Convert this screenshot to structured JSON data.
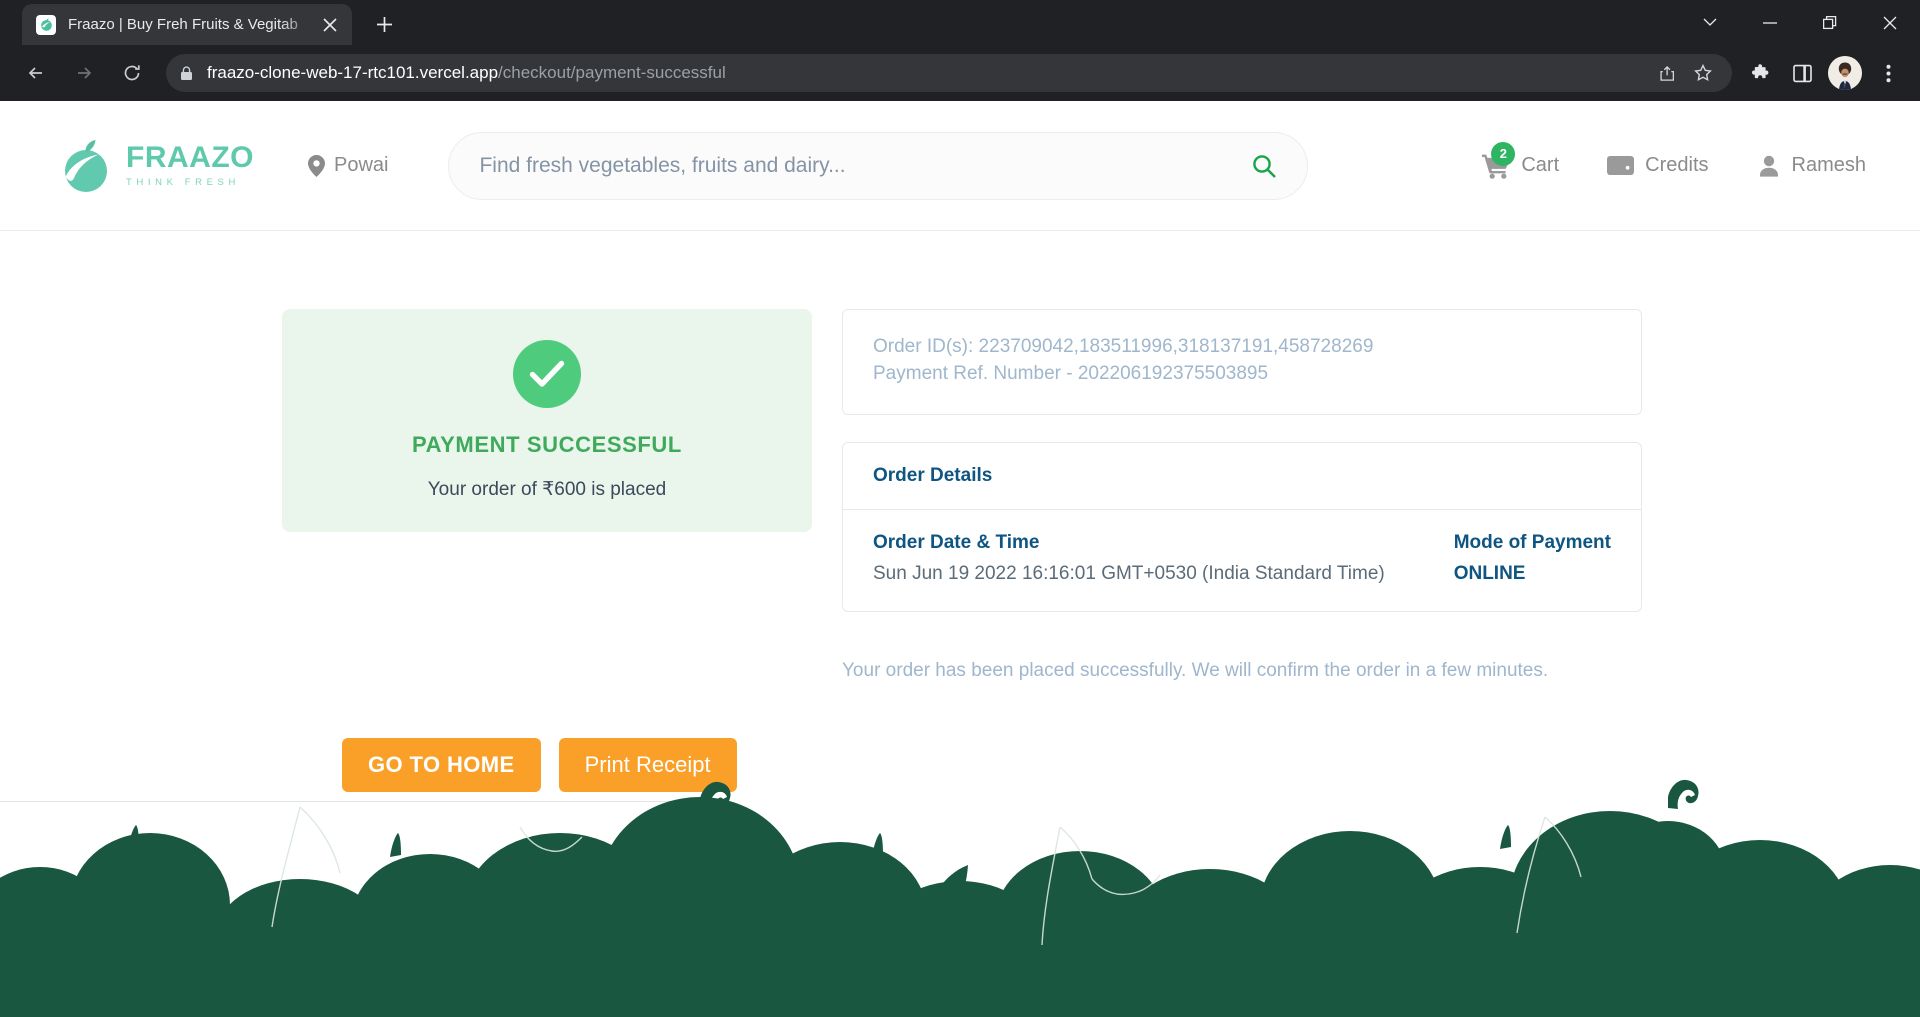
{
  "browser": {
    "tab": {
      "title": "Fraazo | Buy Freh Fruits & Vegitab",
      "favicon_name": "fraazo-favicon",
      "close_label": "✕"
    },
    "new_tab_label": "+",
    "window_controls": {
      "tab_search_label": "∨",
      "minimize_label": "—",
      "maximize_label": "❐",
      "close_label": "✕"
    },
    "nav": {
      "back_label": "←",
      "forward_label": "→",
      "reload_label": "⟳"
    },
    "omnibox": {
      "host": "fraazo-clone-web-17-rtc101.vercel.app",
      "path": "/checkout/payment-successful",
      "lock_icon": "lock-icon",
      "share_icon": "share-icon",
      "bookmark_icon": "star-icon"
    },
    "toolbar": {
      "extensions_icon": "puzzle-icon",
      "side_panel_icon": "side-panel-icon",
      "profile_icon": "profile-avatar",
      "menu_icon": "kebab-menu-icon"
    }
  },
  "site_header": {
    "logo": {
      "name": "FRAAZO",
      "tagline": "THINK FRESH"
    },
    "location": {
      "icon": "location-pin-icon",
      "label": "Powai"
    },
    "search": {
      "placeholder": "Find fresh vegetables, fruits and dairy...",
      "value": "",
      "icon": "search-icon"
    },
    "nav_items": [
      {
        "label": "Cart",
        "icon": "shopping-cart-icon",
        "badge": "2"
      },
      {
        "label": "Credits",
        "icon": "wallet-icon",
        "badge": ""
      },
      {
        "label": "Ramesh",
        "icon": "user-icon",
        "badge": ""
      }
    ]
  },
  "payment": {
    "status_icon": "check-circle-icon",
    "title": "PAYMENT SUCCESSFUL",
    "subtitle": "Your order of ₹600 is placed",
    "amount": "₹600",
    "buttons": {
      "home": "GO TO HOME",
      "print": "Print Receipt"
    }
  },
  "order": {
    "order_ids_line": "Order ID(s): 223709042,183511996,318137191,458728269",
    "order_ids": [
      "223709042",
      "183511996",
      "318137191",
      "458728269"
    ],
    "payment_ref_line": "Payment Ref. Number - 202206192375503895",
    "payment_ref": "202206192375503895",
    "details_heading": "Order Details",
    "date_label": "Order Date & Time",
    "date_value": "Sun Jun 19 2022 16:16:01 GMT+0530 (India Standard Time)",
    "mode_label": "Mode of Payment",
    "mode_value": "ONLINE",
    "confirm_note": "Your order has been placed successfully. We will confirm the order in a few minutes."
  },
  "colors": {
    "brand_green": "#5ec9ab",
    "success_green": "#4ecb7d",
    "success_text": "#3faa5c",
    "success_bg": "#eaf5ec",
    "accent_orange": "#faa028",
    "detail_blue": "#0f5582",
    "muted_blue": "#9fb6cc",
    "footer_green": "#1a5741",
    "badge_green": "#2eb463"
  }
}
